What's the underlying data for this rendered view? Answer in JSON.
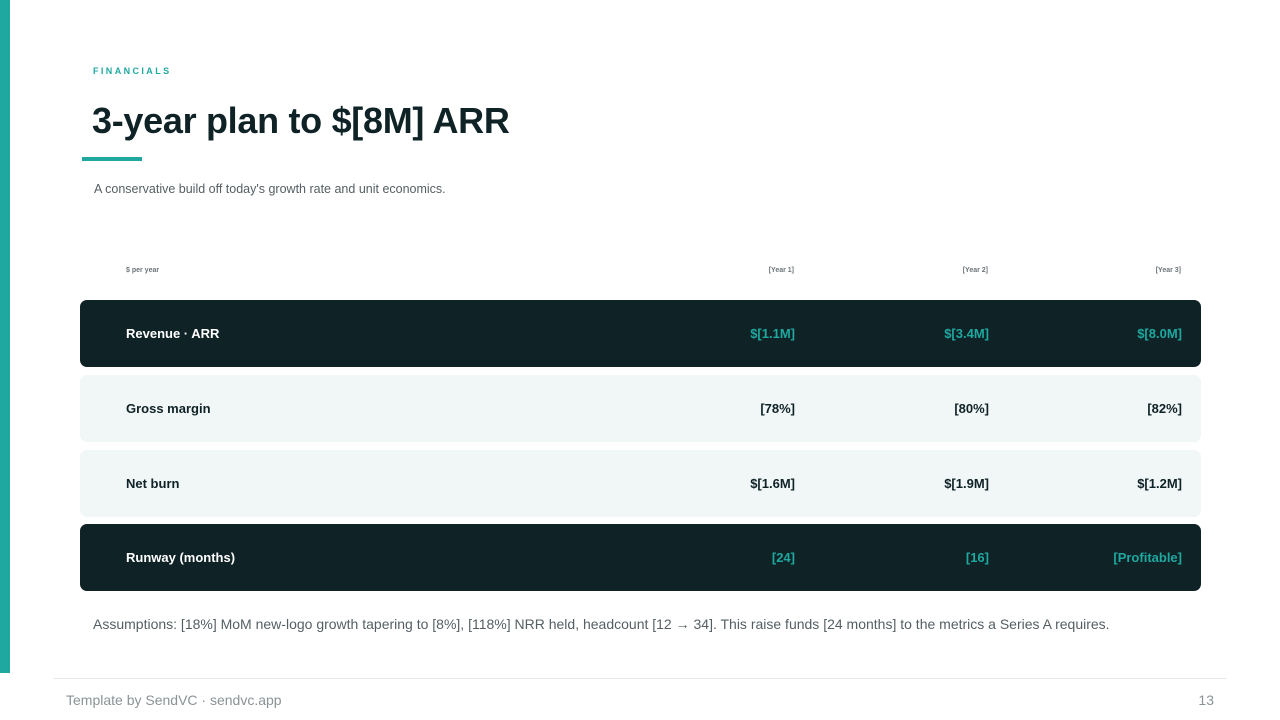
{
  "slide": {
    "eyebrow": "FINANCIALS",
    "title": "3-year plan to $[8M] ARR",
    "subtitle": "A conservative build off today's growth rate and unit economics."
  },
  "colors": {
    "accent": "#1fa8a0",
    "dark": "#0f2226",
    "light_row": "#f1f6f7"
  },
  "table": {
    "headers": {
      "label": "$ per year",
      "years": [
        "[Year 1]",
        "[Year 2]",
        "[Year 3]"
      ]
    },
    "rows": [
      {
        "label": "Revenue · ARR",
        "style": "dark",
        "values": [
          "$[1.1M]",
          "$[3.4M]",
          "$[8.0M]"
        ]
      },
      {
        "label": "Gross margin",
        "style": "light",
        "values": [
          "[78%]",
          "[80%]",
          "[82%]"
        ]
      },
      {
        "label": "Net burn",
        "style": "light",
        "values": [
          "$[1.6M]",
          "$[1.9M]",
          "$[1.2M]"
        ]
      },
      {
        "label": "Runway (months)",
        "style": "dark",
        "values": [
          "[24]",
          "[16]",
          "[Profitable]"
        ]
      }
    ]
  },
  "assumptions": "Assumptions: [18%] MoM new-logo growth tapering to [8%], [118%] NRR held, headcount [12 → 34]. This raise funds [24 months] to the metrics a Series A requires.",
  "footer": {
    "text": "Template by SendVC · sendvc.app",
    "page_number": "13"
  }
}
